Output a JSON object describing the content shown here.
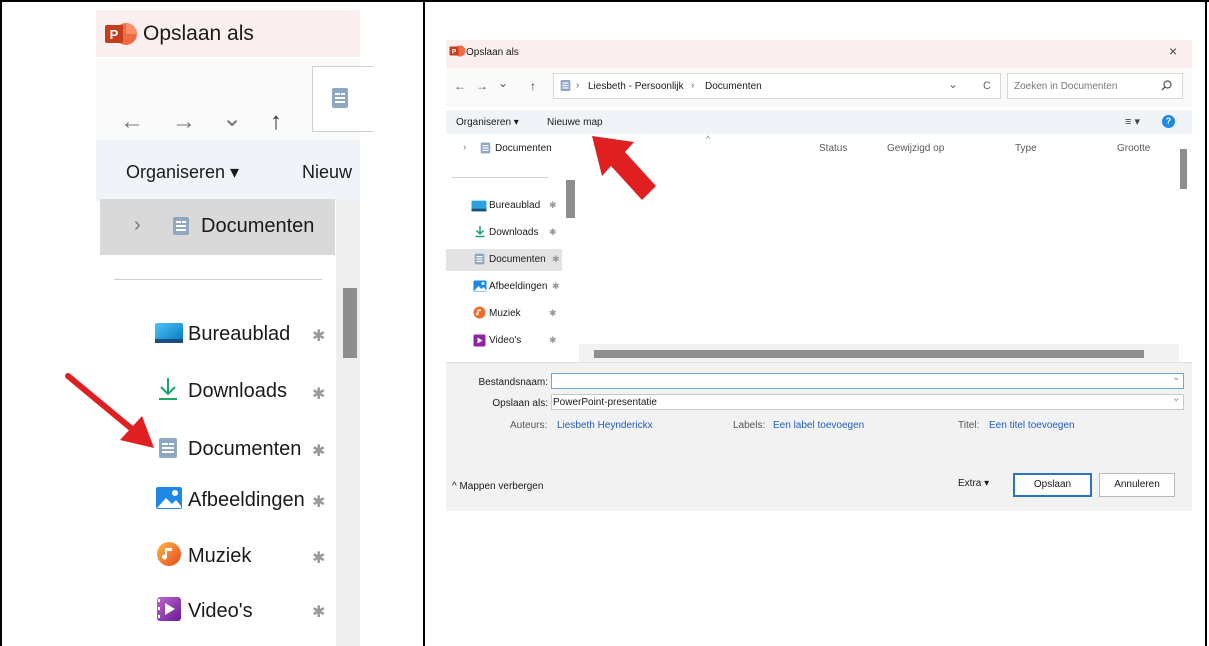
{
  "left_panel": {
    "title": "Opslaan als",
    "nav": {
      "back": "←",
      "forward": "→",
      "dropdown": "⌄",
      "up": "↑"
    },
    "toolbar": {
      "organize": "Organiseren ▾",
      "new_folder_partial": "Nieuw"
    },
    "tree_item": {
      "chevron": "›",
      "label": "Documenten"
    },
    "quick_access": [
      {
        "label": "Bureaublad",
        "icon": "desktop-icon"
      },
      {
        "label": "Downloads",
        "icon": "download-icon"
      },
      {
        "label": "Documenten",
        "icon": "documents-icon"
      },
      {
        "label": "Afbeeldingen",
        "icon": "pictures-icon"
      },
      {
        "label": "Muziek",
        "icon": "music-icon"
      },
      {
        "label": "Video's",
        "icon": "videos-icon"
      }
    ],
    "pin_glyph": "✱"
  },
  "dialog": {
    "title": "Opslaan als",
    "close": "×",
    "nav": {
      "back": "←",
      "forward": "→",
      "dropdown": "⌄",
      "up": "↑"
    },
    "breadcrumb": {
      "sep": "›",
      "parts": [
        "Liesbeth - Persoonlijk",
        "Documenten"
      ]
    },
    "address_dropdown": "⌄",
    "refresh": "C",
    "search": {
      "placeholder": "Zoeken in Documenten",
      "icon": "search-icon"
    },
    "toolbar": {
      "organize": "Organiseren ▾",
      "new_folder": "Nieuwe map",
      "view_icon": "≡ ▾",
      "help": "?"
    },
    "tree_item": {
      "chevron": "›",
      "label": "Documenten"
    },
    "quick_access": [
      {
        "label": "Bureaublad"
      },
      {
        "label": "Downloads"
      },
      {
        "label": "Documenten"
      },
      {
        "label": "Afbeeldingen"
      },
      {
        "label": "Muziek"
      },
      {
        "label": "Video's"
      }
    ],
    "columns": [
      "Status",
      "Gewijzigd op",
      "Type",
      "Grootte"
    ],
    "sort_caret": "^",
    "filename_label": "Bestandsnaam:",
    "filename_value": "",
    "savetype_label": "Opslaan als:",
    "savetype_value": "PowerPoint-presentatie",
    "meta": {
      "authors_label": "Auteurs:",
      "authors_value": "Liesbeth Heynderickx",
      "labels_label": "Labels:",
      "labels_value": "Een label toevoegen",
      "title_label": "Titel:",
      "title_value": "Een titel toevoegen"
    },
    "hide_folders": "^ Mappen verbergen",
    "extra": "Extra ▾",
    "save": "Opslaan",
    "cancel": "Annuleren"
  },
  "colors": {
    "arrow_red": "#e02020",
    "link_blue": "#1f5fbf",
    "selection_grey": "#d9d9d9",
    "title_pink": "#fbeeee",
    "toolbar_blue": "#f0f4f9"
  }
}
